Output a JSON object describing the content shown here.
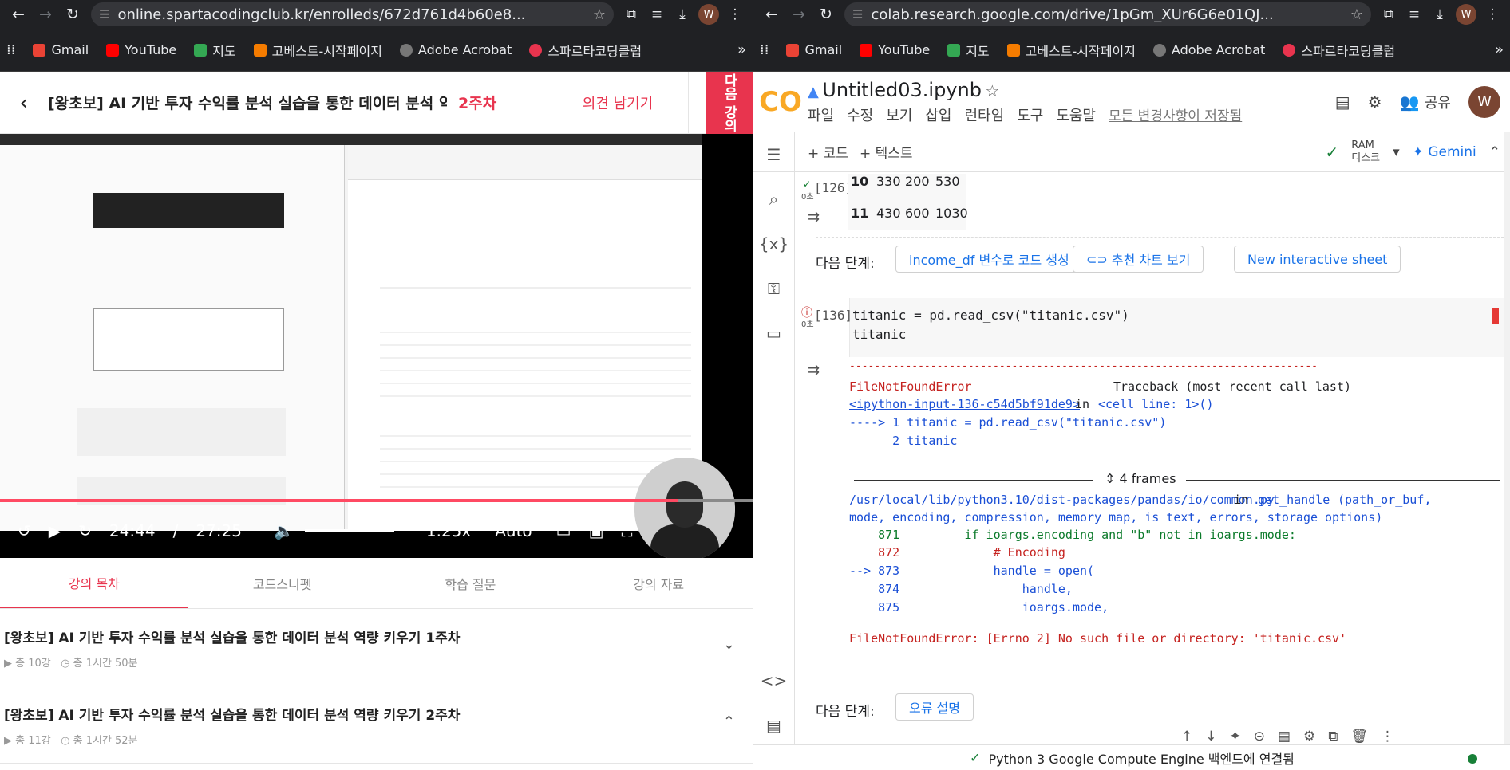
{
  "left": {
    "url": "online.spartacodingclub.kr/enrolleds/672d761d4b60e8...",
    "bookmarks": [
      "Gmail",
      "YouTube",
      "지도",
      "고베스트-시작페이지",
      "Adobe Acrobat",
      "스파르타코딩클럽"
    ],
    "header": {
      "title": "[왕초보] AI 기반 투자 수익률 분석 실습을 통한 데이터 분석 역...",
      "week": "2주차",
      "feedback": "의견 남기기",
      "next": "다음 강의"
    },
    "video": {
      "current_time": "24:44",
      "separator": "/",
      "duration": "27:25",
      "speed": "1.25x",
      "quality": "Auto",
      "progress": 0.9
    },
    "tabs": [
      "강의 목차",
      "코드스니펫",
      "학습 질문",
      "강의 자료"
    ],
    "weeks": [
      {
        "title": "[왕초보] AI 기반 투자 수익률 분석 실습을 통한 데이터 분석 역량 키우기 1주차",
        "count": "총 10강",
        "time": "총 1시간 50분"
      },
      {
        "title": "[왕초보] AI 기반 투자 수익률 분석 실습을 통한 데이터 분석 역량 키우기 2주차",
        "count": "총 11강",
        "time": "총 1시간 52분"
      }
    ]
  },
  "right": {
    "url": "colab.research.google.com/drive/1pGm_XUr6G6e01QJ...",
    "bookmarks": [
      "Gmail",
      "YouTube",
      "지도",
      "고베스트-시작페이지",
      "Adobe Acrobat",
      "스파르타코딩클럽"
    ],
    "notebook_title": "Untitled03.ipynb",
    "menu": [
      "파일",
      "수정",
      "보기",
      "삽입",
      "런타임",
      "도구",
      "도움말"
    ],
    "save_status": "모든 변경사항이 저장됨",
    "share": "공유",
    "avatar": "W",
    "toolbar": {
      "add_code": "+ 코드",
      "add_text": "+ 텍스트",
      "ram": "RAM",
      "disk": "디스크",
      "gemini": "Gemini"
    },
    "prev_cell": {
      "counter": "[126]",
      "time": "0초",
      "rows": [
        [
          "10",
          "330",
          "200",
          "530"
        ],
        [
          "11",
          "430",
          "600",
          "1030"
        ]
      ]
    },
    "next_steps_label": "다음 단계:",
    "next_steps": [
      "income_df 변수로 코드 생성",
      "추천 차트 보기",
      "New interactive sheet"
    ],
    "cell": {
      "counter": "[136]",
      "time": "0초",
      "line1": "titanic = pd.read_csv(\"titanic.csv\")",
      "line2": "titanic"
    },
    "traceback": {
      "dashes": "---------------------------------------------------------------------------",
      "error": "FileNotFoundError",
      "traceback_label": "Traceback (most recent call last)",
      "input_link": "<ipython-input-136-c54d5bf91de9>",
      "in_word": "in",
      "cell_line": "<cell line: 1>()",
      "arrow_line": "----> 1 titanic = pd.read_csv(\"titanic.csv\")",
      "line2": "      2 titanic",
      "frames": "4 frames",
      "file_link": "/usr/local/lib/python3.10/dist-packages/pandas/io/common.py",
      "in_word2": "in",
      "func": "get_handle",
      "args1": "(path_or_buf,",
      "args2": "mode, encoding, compression, memory_map, is_text, errors, storage_options)",
      "l871": "    871         if ioargs.encoding and \"b\" not in ioargs.mode:",
      "l872": "    872             # Encoding",
      "l873": "--> 873             handle = open(",
      "l874": "    874                 handle,",
      "l875": "    875                 ioargs.mode,",
      "final": "FileNotFoundError: [Errno 2] No such file or directory: 'titanic.csv'"
    },
    "next_steps2": [
      "오류 설명"
    ],
    "status": "Python 3 Google Compute Engine 백엔드에 연결됨"
  }
}
